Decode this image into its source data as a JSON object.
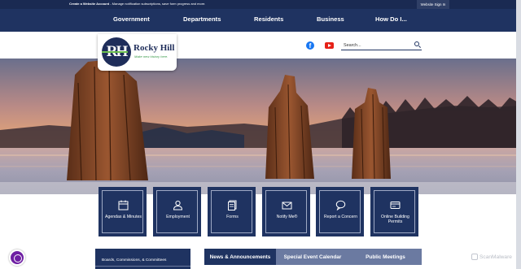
{
  "utility_bar": {
    "create_account_bold": "Create a Website Account",
    "create_account_rest": " - Manage notification subscriptions, save form progress and more.",
    "sign_in": "Website Sign In"
  },
  "nav": {
    "items": [
      "Government",
      "Departments",
      "Residents",
      "Business",
      "How Do I..."
    ]
  },
  "logo": {
    "monogram": "RH",
    "name": "Rocky Hill",
    "tagline": "Make new history here."
  },
  "social": {
    "facebook_icon": "facebook-icon",
    "youtube_icon": "youtube-icon"
  },
  "search": {
    "placeholder": "Search..."
  },
  "quick_links": [
    {
      "label": "Agendas & Minutes",
      "icon": "calendar-icon"
    },
    {
      "label": "Employment",
      "icon": "person-icon"
    },
    {
      "label": "Forms",
      "icon": "documents-icon"
    },
    {
      "label": "Notify Me®",
      "icon": "envelope-icon"
    },
    {
      "label": "Report a Concern",
      "icon": "chat-bubble-icon"
    },
    {
      "label": "Online Building Permits",
      "icon": "card-icon"
    }
  ],
  "boards": {
    "label": "Boards, Commissions, & Committees"
  },
  "tabs": [
    {
      "label": "News & Announcements",
      "active": true
    },
    {
      "label": "Special Event Calendar",
      "active": false
    },
    {
      "label": "Public Meetings",
      "active": false
    }
  ],
  "badge": {
    "text": "ScanMalware"
  },
  "colors": {
    "navy": "#1f3361",
    "utility_navy": "#1a2a52",
    "tab_inactive": "#6b7aa1",
    "accent_green": "#6bbf4e",
    "accessibility_purple": "#6e1fa3"
  }
}
